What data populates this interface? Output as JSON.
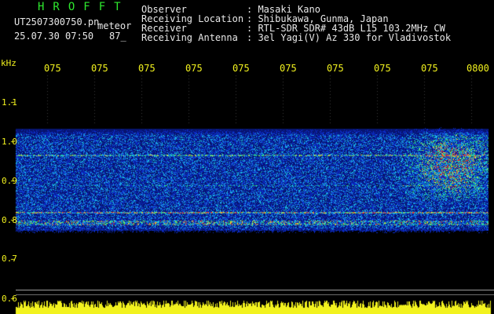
{
  "header": {
    "title": "HROFFT",
    "filename": "UT2507300750.pn",
    "suffix": "meteor",
    "datetime": "25.07.30 07:50",
    "count": "87_",
    "labels": [
      "Observer",
      "Receiving Location",
      "Receiver",
      "Receiving Antenna"
    ],
    "values": [
      ": Masaki Kano",
      ": Shibukawa, Gunma, Japan",
      ": RTL-SDR SDR# 43dB L15 103.2MHz CW",
      ": 3el Yagi(V) Az 330 for Vladivostok"
    ]
  },
  "axis": {
    "unit": "kHz",
    "time_ticks": [
      "075",
      "075",
      "075",
      "075",
      "075",
      "075",
      "075",
      "075",
      "075",
      "0800"
    ],
    "freq_labels": [
      "1.1",
      "1.0",
      "0.9",
      "0.8",
      "0.7",
      "0.6"
    ]
  },
  "colors": {
    "header_title": "#2ee82e",
    "header_text": "#e8e8e8",
    "ticks": "#f2f21e",
    "waterfall_base": "#0a1c9c"
  }
}
